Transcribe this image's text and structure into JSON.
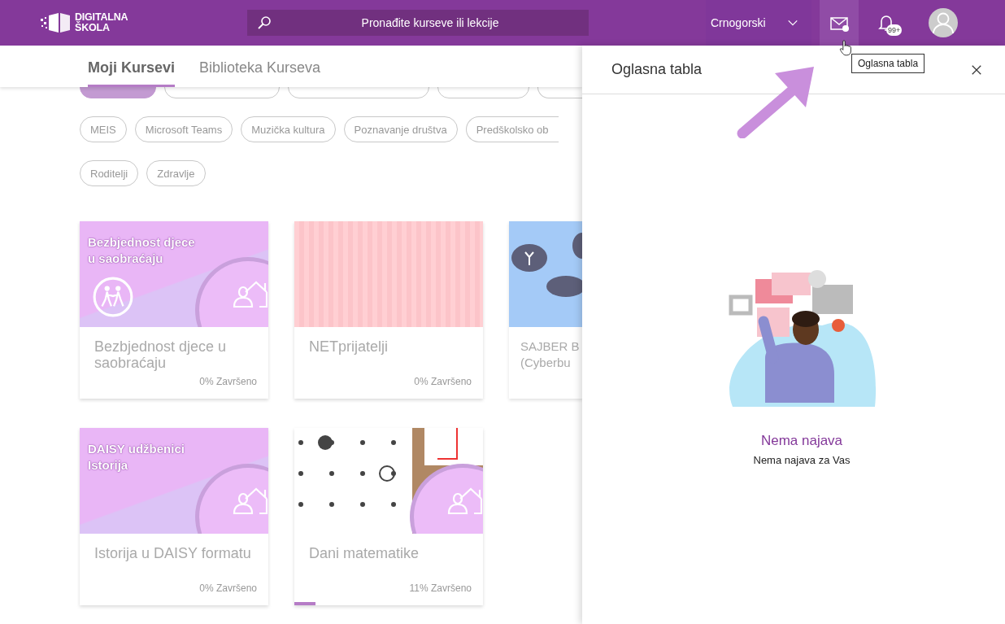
{
  "header": {
    "logo": {
      "lines": [
        "DIGITALNA",
        "ŠKOLA"
      ]
    },
    "search": {
      "placeholder": "Pronađite kurseve ili lekcije"
    },
    "language": {
      "label": "Crnogorski"
    },
    "announcements_button": {
      "hovered": true,
      "tooltip": "Oglasna tabla"
    },
    "notifications": {
      "badge": "99+"
    }
  },
  "tabs": [
    {
      "label": "Moji Kursevi",
      "selected": true
    },
    {
      "label": "Biblioteka Kurseva",
      "selected": false
    }
  ],
  "filter_rows": [
    {
      "chips": [
        {
          "selected": true
        },
        {
          "selected": false
        },
        {
          "selected": false
        },
        {
          "selected": false
        },
        {
          "selected": false
        }
      ]
    },
    {
      "chips": [
        {
          "label": "MEIS",
          "selected": false
        },
        {
          "label": "Microsoft Teams",
          "selected": false
        },
        {
          "label": "Muzička kultura",
          "selected": false
        },
        {
          "label": "Poznavanje društva",
          "selected": false
        },
        {
          "label": "Predškolsko ob",
          "selected": false
        }
      ]
    },
    {
      "chips": [
        {
          "label": "Roditelji",
          "selected": false
        },
        {
          "label": "Zdravlje",
          "selected": false
        }
      ]
    }
  ],
  "course_rows": [
    {
      "cards": [
        {
          "kind": "banner",
          "banner_lines": [
            "Bezbjednost djece",
            "u saobraćaju"
          ],
          "emblem": true,
          "title": "Bezbjednost djece u saobraćaju",
          "progress": "0% Završeno",
          "level": 0
        },
        {
          "kind": "girl-laptop",
          "title": "NETprijatelji",
          "progress": "0% Završeno",
          "level": 0
        },
        {
          "kind": "chat-bubbles",
          "title_lines": [
            "SAJBER B",
            "(Cyberbu"
          ]
        }
      ]
    },
    {
      "cards": [
        {
          "kind": "banner",
          "banner_lines": [
            "DAISY  udžbenici",
            "Istorija"
          ],
          "emblem": false,
          "title": "Istorija u DAISY formatu",
          "progress": "0% Završeno",
          "level": 0
        },
        {
          "kind": "dot-puzzle",
          "title": "Dani matematike",
          "progress": "11% Završeno",
          "level": 0.11
        }
      ]
    }
  ],
  "panel": {
    "title": "Oglasna tabla",
    "empty_title": "Nema najava",
    "empty_text": "Nema najava za Vas"
  }
}
